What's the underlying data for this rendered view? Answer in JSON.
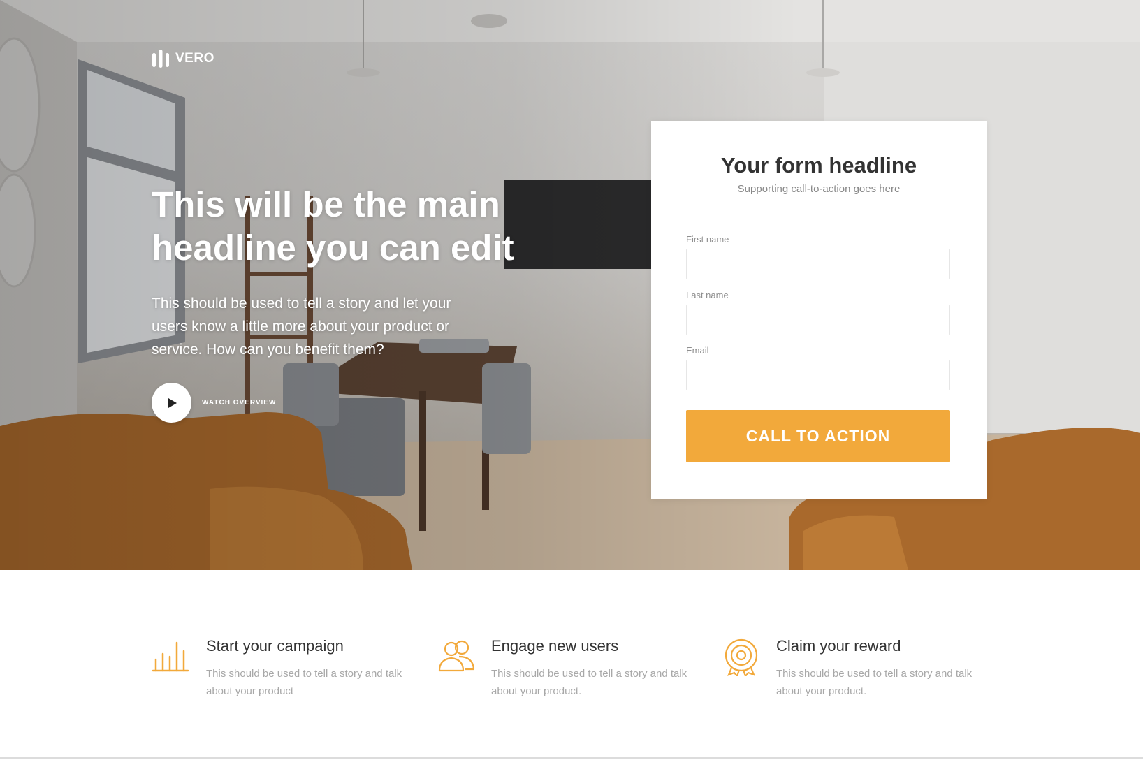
{
  "colors": {
    "accent": "#f2a93b",
    "hero_text": "#ffffff",
    "heading_dark": "#333333",
    "muted": "#a8a8a8"
  },
  "brand": {
    "logo_icon": "vero-bars-icon",
    "name": "VERO"
  },
  "hero": {
    "headline": "This will be the main headline you can edit",
    "body": "This should be used to tell a story and let your users know a little more about your product or service. How can you benefit them?",
    "watch_icon": "play-icon",
    "watch_label": "WATCH OVERVIEW"
  },
  "form": {
    "title": "Your form headline",
    "subtitle": "Supporting call-to-action goes here",
    "fields": [
      {
        "label": "First name",
        "value": "",
        "placeholder": ""
      },
      {
        "label": "Last name",
        "value": "",
        "placeholder": ""
      },
      {
        "label": "Email",
        "value": "",
        "placeholder": ""
      }
    ],
    "cta_label": "CALL TO ACTION"
  },
  "features": [
    {
      "icon": "bar-chart-icon",
      "title": "Start your campaign",
      "text": "This should be used to tell a story and talk about your product"
    },
    {
      "icon": "users-icon",
      "title": "Engage new users",
      "text": "This should be used to tell a story and talk about your product."
    },
    {
      "icon": "target-award-icon",
      "title": "Claim your reward",
      "text": "This should be used to tell a story and talk about your product."
    }
  ]
}
